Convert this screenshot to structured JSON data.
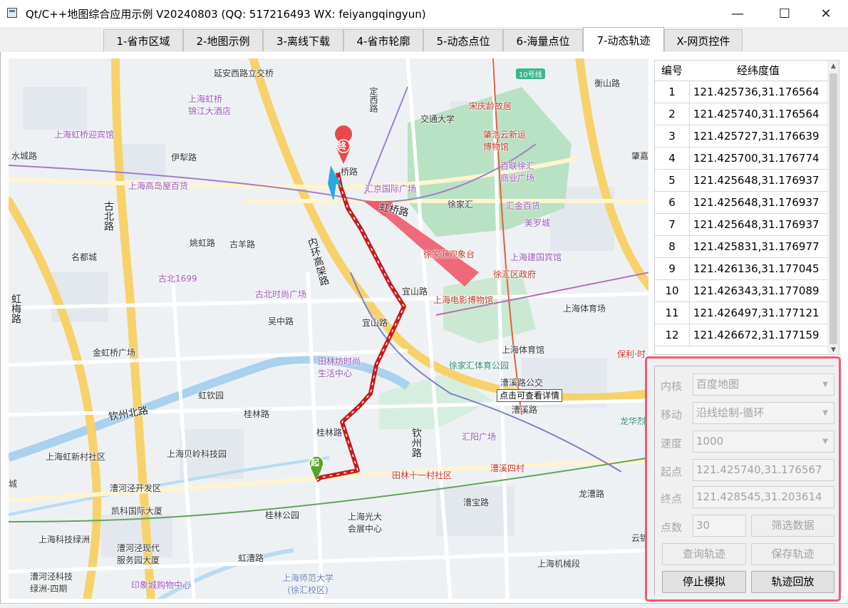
{
  "window": {
    "title": "Qt/C++地图综合应用示例 V20240803 (QQ: 517216493 WX: feiyangqingyun)",
    "minimize": "—",
    "maximize": "☐",
    "close": "✕"
  },
  "tabs": [
    {
      "label": "1-省市区域"
    },
    {
      "label": "2-地图示例"
    },
    {
      "label": "3-离线下载"
    },
    {
      "label": "4-省市轮廓"
    },
    {
      "label": "5-动态点位"
    },
    {
      "label": "6-海量点位"
    },
    {
      "label": "7-动态轨迹"
    },
    {
      "label": "X-网页控件"
    }
  ],
  "map": {
    "labels": {
      "yanan": "延安西路立交桥",
      "hongqiao_hotel": "上海虹桥\n锦江大酒店",
      "guest_house": "上海虹桥迎宾馆",
      "shuicheng": "水城路",
      "yili": "伊犁路",
      "gaodao": "上海高岛屋百货",
      "dingxi": "定西路",
      "jiaoda": "交通大学",
      "songqingling": "宋庆龄故居",
      "zhaohao": "肇浩云新运\n博物馆",
      "bailian": "百联徐汇\n商业广场",
      "hengshan": "衡山路",
      "zhaojia": "肇嘉",
      "line10": "10号线",
      "yaoqiao": "桥路",
      "huijing": "汇京国际广场",
      "xujiahui": "徐家汇",
      "huijin": "汇金百货",
      "meiluo": "美罗城",
      "hongqiao_road": "虹桥路",
      "gubei": "古北路",
      "yaohong": "姚虹路",
      "guyang": "古羊路",
      "neihuan": "内环高架路",
      "mingdu": "名都城",
      "gubei1699": "古北1699",
      "gubei_square": "古北时尚广场",
      "guanxiang": "徐家汇观象台",
      "jianguo": "上海建国宾馆",
      "xuhui_gov": "徐汇区政府",
      "yishan1": "宜山路",
      "film": "上海电影博物馆",
      "sports_stadium": "上海体育场",
      "hongmei": "虹梅路",
      "wuzhong": "吴中路",
      "yishan2": "宜山路",
      "jinhongqiao": "金虹桥广场",
      "tianhuan": "田林坊时尚\n生活中心",
      "sports_hall": "上海体育馆",
      "baoli": "保利·时",
      "xjh_park": "徐家汇体育公园",
      "caoxi_bus": "漕溪路公交",
      "caoxi": "漕溪路",
      "hongyuan": "虹钦园",
      "qinzhou": "钦州北路",
      "guilin": "桂林路",
      "guilin2": "桂林路",
      "qinzhou2": "钦州路",
      "huiyang": "汇阳广场",
      "longhua": "龙华烈",
      "hongxin": "上海虹新村社区",
      "beiling": "上海贝岭科技园",
      "tianlin": "田林十一村社区",
      "caoxi4": "漕溪四村",
      "caohejing": "漕河泾开发区",
      "kaike": "凯科国际大厦",
      "cheng": "城",
      "caobao": "漕宝路",
      "longcao": "龙漕路",
      "guilin_park": "桂林公园",
      "guangda": "上海光大\n会展中心",
      "keji_green": "上海科技绿洲",
      "caohejing_modern": "漕河泾现代\n服务园大厦",
      "hongcao": "虹漕路",
      "yunjin": "云锦",
      "jixie": "上海机械段",
      "caohejing_green4": "漕河泾科技\n绿洲-四期",
      "yinxiang": "印象城购物中心",
      "shida": "上海师范大学\n(徐汇校区)",
      "start": "起",
      "end": "终"
    },
    "tooltip": "点击可查看详情"
  },
  "table": {
    "headers": [
      "编号",
      "经纬度值"
    ],
    "rows": [
      {
        "id": "1",
        "value": "121.425736,31.176564"
      },
      {
        "id": "2",
        "value": "121.425740,31.176564"
      },
      {
        "id": "3",
        "value": "121.425727,31.176639"
      },
      {
        "id": "4",
        "value": "121.425700,31.176774"
      },
      {
        "id": "5",
        "value": "121.425648,31.176937"
      },
      {
        "id": "6",
        "value": "121.425648,31.176937"
      },
      {
        "id": "7",
        "value": "121.425648,31.176937"
      },
      {
        "id": "8",
        "value": "121.425831,31.176977"
      },
      {
        "id": "9",
        "value": "121.426136,31.177045"
      },
      {
        "id": "10",
        "value": "121.426343,31.177089"
      },
      {
        "id": "11",
        "value": "121.426497,31.177121"
      },
      {
        "id": "12",
        "value": "121.426672,31.177159"
      }
    ]
  },
  "panel": {
    "kernel_label": "内核",
    "kernel_value": "百度地图",
    "move_label": "移动",
    "move_value": "沿线绘制-循环",
    "speed_label": "速度",
    "speed_value": "1000",
    "start_label": "起点",
    "start_value": "121.425740,31.176567",
    "end_label": "终点",
    "end_value": "121.428545,31.203614",
    "count_label": "点数",
    "count_value": "30",
    "filter_button": "筛选数据",
    "query_button": "查询轨迹",
    "save_button": "保存轨迹",
    "stop_button": "停止模拟",
    "replay_button": "轨迹回放"
  },
  "colors": {
    "accent_border": "#ef5b70",
    "track": "#c81a1a",
    "arrow": "#f05a6e"
  }
}
